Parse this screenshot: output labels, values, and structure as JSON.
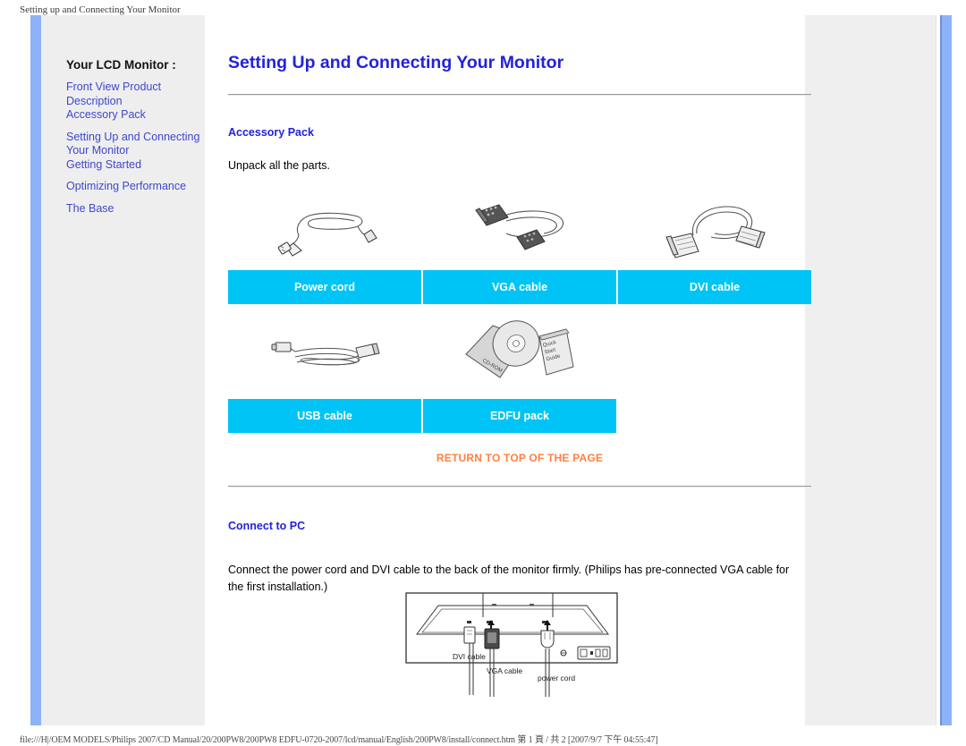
{
  "browser": {
    "print_header": "Setting up and Connecting Your Monitor",
    "print_footer": "file:///H|/OEM MODELS/Philips 2007/CD Manual/20/200PW8/200PW8 EDFU-0720-2007/lcd/manual/English/200PW8/install/connect.htm 第 1 頁 / 共 2 [2007/9/7 下午 04:55:47]"
  },
  "sidebar": {
    "title": "Your LCD Monitor :",
    "groups": [
      {
        "items": [
          {
            "label": "Front View Product"
          },
          {
            "label": "Description"
          },
          {
            "label": "Accessory Pack"
          }
        ]
      },
      {
        "items": [
          {
            "label": "Setting Up and Connecting"
          },
          {
            "label": "Your Monitor"
          },
          {
            "label": "Getting Started"
          }
        ]
      },
      {
        "items": [
          {
            "label": "Optimizing Performance"
          }
        ]
      },
      {
        "items": [
          {
            "label": "The Base"
          }
        ]
      }
    ]
  },
  "main": {
    "page_title": "Setting Up and Connecting Your Monitor",
    "accessory": {
      "heading": "Accessory Pack",
      "intro": "Unpack all the parts.",
      "row1": [
        {
          "label": "Power cord",
          "icon": "power-cord-image"
        },
        {
          "label": "VGA cable",
          "icon": "vga-cable-image"
        },
        {
          "label": "DVI cable",
          "icon": "dvi-cable-image"
        }
      ],
      "row2": [
        {
          "label": "USB cable",
          "icon": "usb-cable-image"
        },
        {
          "label": "EDFU pack",
          "icon": "edfu-pack-image"
        }
      ],
      "return_to_top": "RETURN TO TOP OF THE PAGE"
    },
    "connect": {
      "heading": "Connect to PC",
      "paragraph": "Connect the power cord and DVI cable to the back of the monitor firmly. (Philips has pre-connected VGA cable for the first installation.)",
      "diagram_labels": {
        "dvi": "DVI cable",
        "vga": "VGA cable",
        "power": "power cord"
      }
    }
  },
  "colors": {
    "link_blue": "#3f48cc",
    "heading_blue": "#2222dd",
    "cyan_bar": "#00c4f5",
    "orange_link": "#ff8040",
    "accent_bar": "#8eb2f7",
    "panel_grey": "#eeeeee"
  }
}
